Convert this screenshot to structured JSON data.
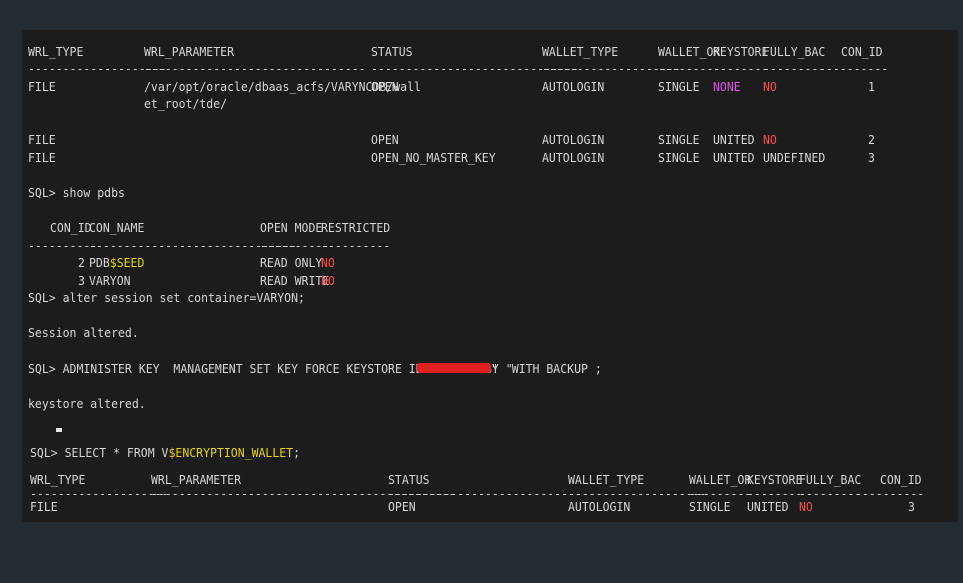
{
  "table1": {
    "headers": [
      "WRL_TYPE",
      "WRL_PARAMETER",
      "STATUS",
      "WALLET_TYPE",
      "WALLET_OR",
      "KEYSTORE",
      "FULLY_BAC",
      "CON_ID"
    ],
    "dashes": [
      "--------------------",
      "--------------------------------",
      "------------------------------",
      "--------------------",
      "---------",
      "--------",
      "---------",
      "----------"
    ],
    "rows": [
      {
        "wrl_type": "FILE",
        "wrl_param_1": "/var/opt/oracle/dbaas_acfs/VARYNCDB/wall",
        "wrl_param_2": "et_root/tde/",
        "status": "OPEN",
        "wallet_type": "AUTOLOGIN",
        "wallet_or": "SINGLE",
        "keystore": "NONE",
        "fully_bac": "NO",
        "con_id": "1"
      },
      {
        "wrl_type": "FILE",
        "status": "OPEN",
        "wallet_type": "AUTOLOGIN",
        "wallet_or": "SINGLE",
        "keystore": "UNITED",
        "fully_bac": "NO",
        "con_id": "2"
      },
      {
        "wrl_type": "FILE",
        "status": "OPEN_NO_MASTER_KEY",
        "wallet_type": "AUTOLOGIN",
        "wallet_or": "SINGLE",
        "keystore": "UNITED",
        "fully_bac": "UNDEFINED",
        "con_id": "3"
      }
    ]
  },
  "cmd_show_pdbs": "SQL> show pdbs",
  "pdbs": {
    "headers": [
      "CON_ID",
      "CON_NAME",
      "OPEN MODE",
      "RESTRICTED"
    ],
    "dashes": [
      "----------",
      "------------------------------",
      "----------",
      "----------"
    ],
    "rows": [
      {
        "con_id": "2",
        "name_a": "PDB",
        "name_b": "$SEED",
        "open_mode": "READ ONLY",
        "restricted": "NO"
      },
      {
        "con_id": "3",
        "name_a": "VARYON",
        "name_b": "",
        "open_mode": "READ WRITE",
        "restricted": "NO"
      }
    ]
  },
  "cmd_alter": "SQL> alter session set container=VARYON;",
  "msg_session": "Session altered.",
  "cmd_admin_a": "SQL> ADMINISTER KEY  MANAGEMENT SET KEY FORCE KEYSTORE IDENTIFIED BY \"",
  "cmd_admin_b": "\"  WITH BACKUP ;",
  "msg_keystore": "keystore altered.",
  "cmd_select_a": "SQL> SELECT * FROM V",
  "cmd_select_b": "$ENCRYPTION_WALLET",
  "cmd_select_c": ";",
  "table2": {
    "headers": [
      "WRL_TYPE",
      "WRL_PARAMETER",
      "STATUS",
      "WALLET_TYPE",
      "WALLET_OR",
      "KEYSTORE",
      "FULLY_BAC",
      "CON_ID"
    ],
    "dashes": [
      "--------------------",
      "--------------------------------------------",
      "------------------------------",
      "--------------------",
      "---------",
      "--------",
      "---------",
      "----------"
    ],
    "row": {
      "wrl_type": "FILE",
      "status": "OPEN",
      "wallet_type": "AUTOLOGIN",
      "wallet_or": "SINGLE",
      "keystore": "UNITED",
      "fully_bac": "NO",
      "con_id": "3"
    }
  },
  "colors": {
    "page": "#242c31",
    "terminal": "#1c1c1c",
    "text": "#d6d6d6",
    "no": "#ff4a4a",
    "none": "#e052e0",
    "seed": "#e8d40c",
    "redaction": "#e02020"
  }
}
